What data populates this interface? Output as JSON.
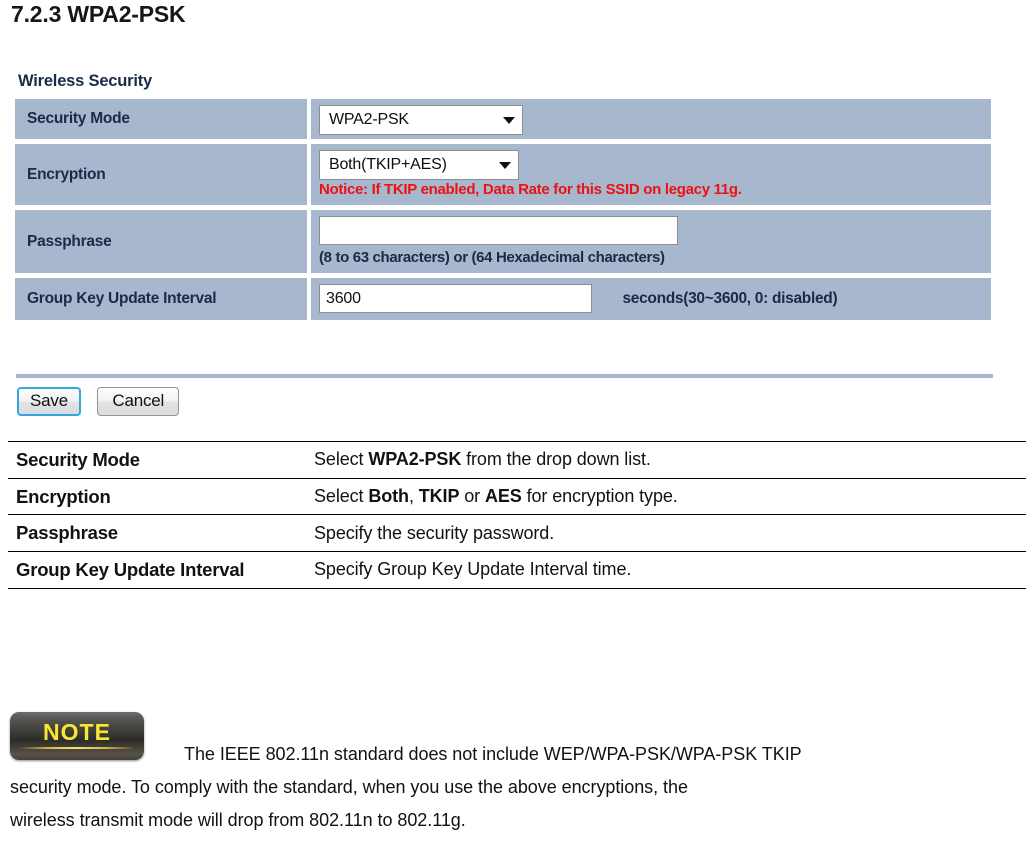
{
  "heading": "7.2.3 WPA2-PSK",
  "panel": {
    "title": "Wireless Security",
    "rows": {
      "security_mode": {
        "label": "Security Mode",
        "value": "WPA2-PSK"
      },
      "encryption": {
        "label": "Encryption",
        "value": "Both(TKIP+AES)",
        "notice": "Notice: If TKIP enabled, Data Rate for this SSID on legacy 11g."
      },
      "passphrase": {
        "label": "Passphrase",
        "value": "",
        "placeholder": "",
        "hint": "(8 to 63 characters) or (64 Hexadecimal characters)"
      },
      "group_key_update_interval": {
        "label": "Group Key Update Interval",
        "value": "3600",
        "suffix": "seconds(30~3600, 0: disabled)"
      }
    },
    "buttons": {
      "save": "Save",
      "cancel": "Cancel"
    },
    "colors": {
      "cell_background": "#a7b7ce",
      "label_text": "#1b2a47",
      "notice_text": "#ee1111",
      "save_focus_ring": "#33a8e0"
    }
  },
  "description_table": {
    "rows": [
      {
        "term": "Security Mode",
        "def_pre": "Select ",
        "def_bold": "WPA2-PSK",
        "def_post": " from the drop down list.",
        "def_full": "Select WPA2-PSK from the drop down list."
      },
      {
        "term": "Encryption",
        "def_pre": "Select ",
        "def_bold": "Both",
        "def_mid1": ", ",
        "def_bold2": "TKIP",
        "def_mid2": " or ",
        "def_bold3": "AES",
        "def_post": " for encryption type.",
        "def_full": "Select Both, TKIP or AES for encryption type."
      },
      {
        "term": "Passphrase",
        "def_full": "Specify the security password."
      },
      {
        "term": "Group Key Update Interval",
        "def_full": "Specify Group Key Update Interval time."
      }
    ]
  },
  "note": {
    "badge_label": "NOTE",
    "line1": "The IEEE 802.11n standard does not include WEP/WPA-PSK/WPA-PSK TKIP",
    "line2": "security mode. To comply with the standard, when you use the above encryptions, the",
    "line3": "wireless transmit mode will drop from 802.11n to 802.11g."
  }
}
